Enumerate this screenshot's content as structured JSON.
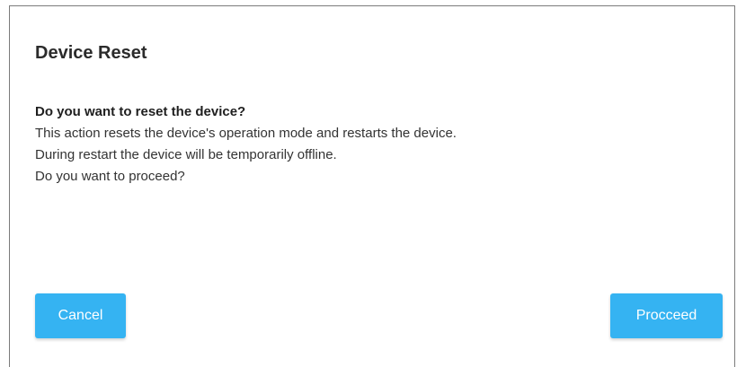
{
  "dialog": {
    "title": "Device Reset",
    "question": "Do you want to reset the device?",
    "lines": [
      "This action resets the device's operation mode and restarts the device.",
      "During restart the device will be temporarily offline.",
      "Do you want to proceed?"
    ],
    "buttons": {
      "cancel_label": "Cancel",
      "proceed_label": "Procceed"
    }
  },
  "colors": {
    "button_background": "#35b3f2",
    "button_text": "#ffffff",
    "title_text": "#2b2b2b",
    "body_text": "#333333",
    "border": "#7b7b7b"
  }
}
